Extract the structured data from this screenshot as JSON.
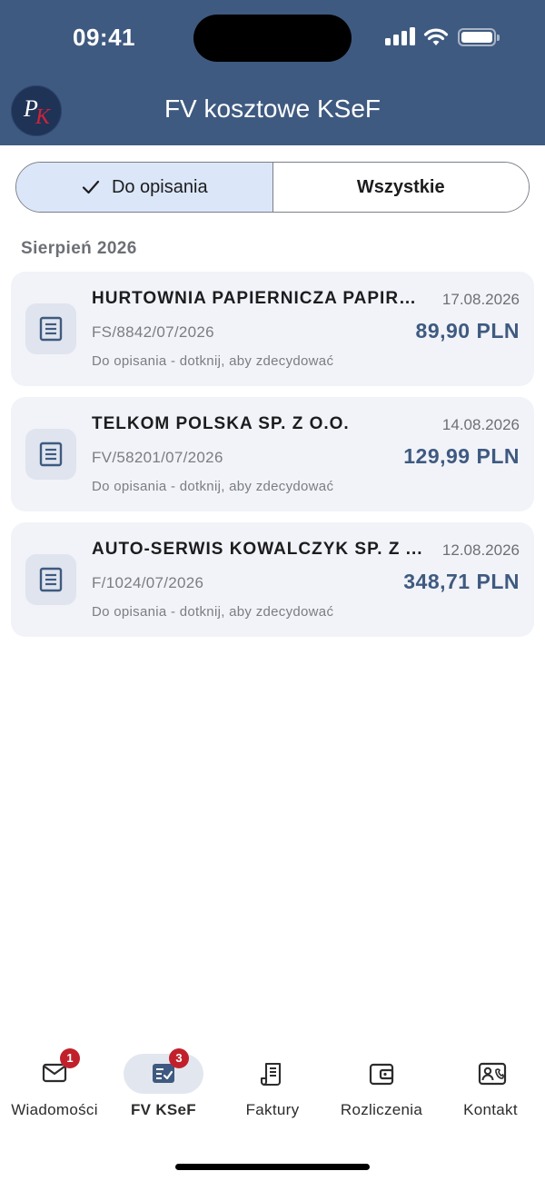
{
  "status_bar": {
    "time": "09:41"
  },
  "header": {
    "title": "FV kosztowe KSeF",
    "logo_initials": "PK"
  },
  "filter": {
    "active_label": "Do opisania",
    "inactive_label": "Wszystkie"
  },
  "section": {
    "title": "Sierpień 2026"
  },
  "invoices": [
    {
      "vendor": "HURTOWNIA PAPIERNICZA PAPIRU...",
      "date": "17.08.2026",
      "number": "FS/8842/07/2026",
      "amount": "89,90 PLN",
      "status": "Do opisania - dotknij, aby zdecydować"
    },
    {
      "vendor": "TELKOM POLSKA SP. Z O.O.",
      "date": "14.08.2026",
      "number": "FV/58201/07/2026",
      "amount": "129,99 PLN",
      "status": "Do opisania - dotknij, aby zdecydować"
    },
    {
      "vendor": "AUTO-SERWIS KOWALCZYK SP. Z ...",
      "date": "12.08.2026",
      "number": "F/1024/07/2026",
      "amount": "348,71 PLN",
      "status": "Do opisania - dotknij, aby zdecydować"
    }
  ],
  "tabbar": {
    "items": [
      {
        "label": "Wiadomości",
        "icon": "envelope-icon",
        "badge": "1"
      },
      {
        "label": "FV KSeF",
        "icon": "invoice-check-icon",
        "badge": "3"
      },
      {
        "label": "Faktury",
        "icon": "receipt-icon"
      },
      {
        "label": "Rozliczenia",
        "icon": "wallet-icon"
      },
      {
        "label": "Kontakt",
        "icon": "contact-card-icon"
      }
    ]
  },
  "colors": {
    "header": "#3f5a80",
    "accent": "#3f5a80",
    "segment_active": "#dbe6f8",
    "card": "#f1f3f8",
    "badge": "#c1202b"
  }
}
